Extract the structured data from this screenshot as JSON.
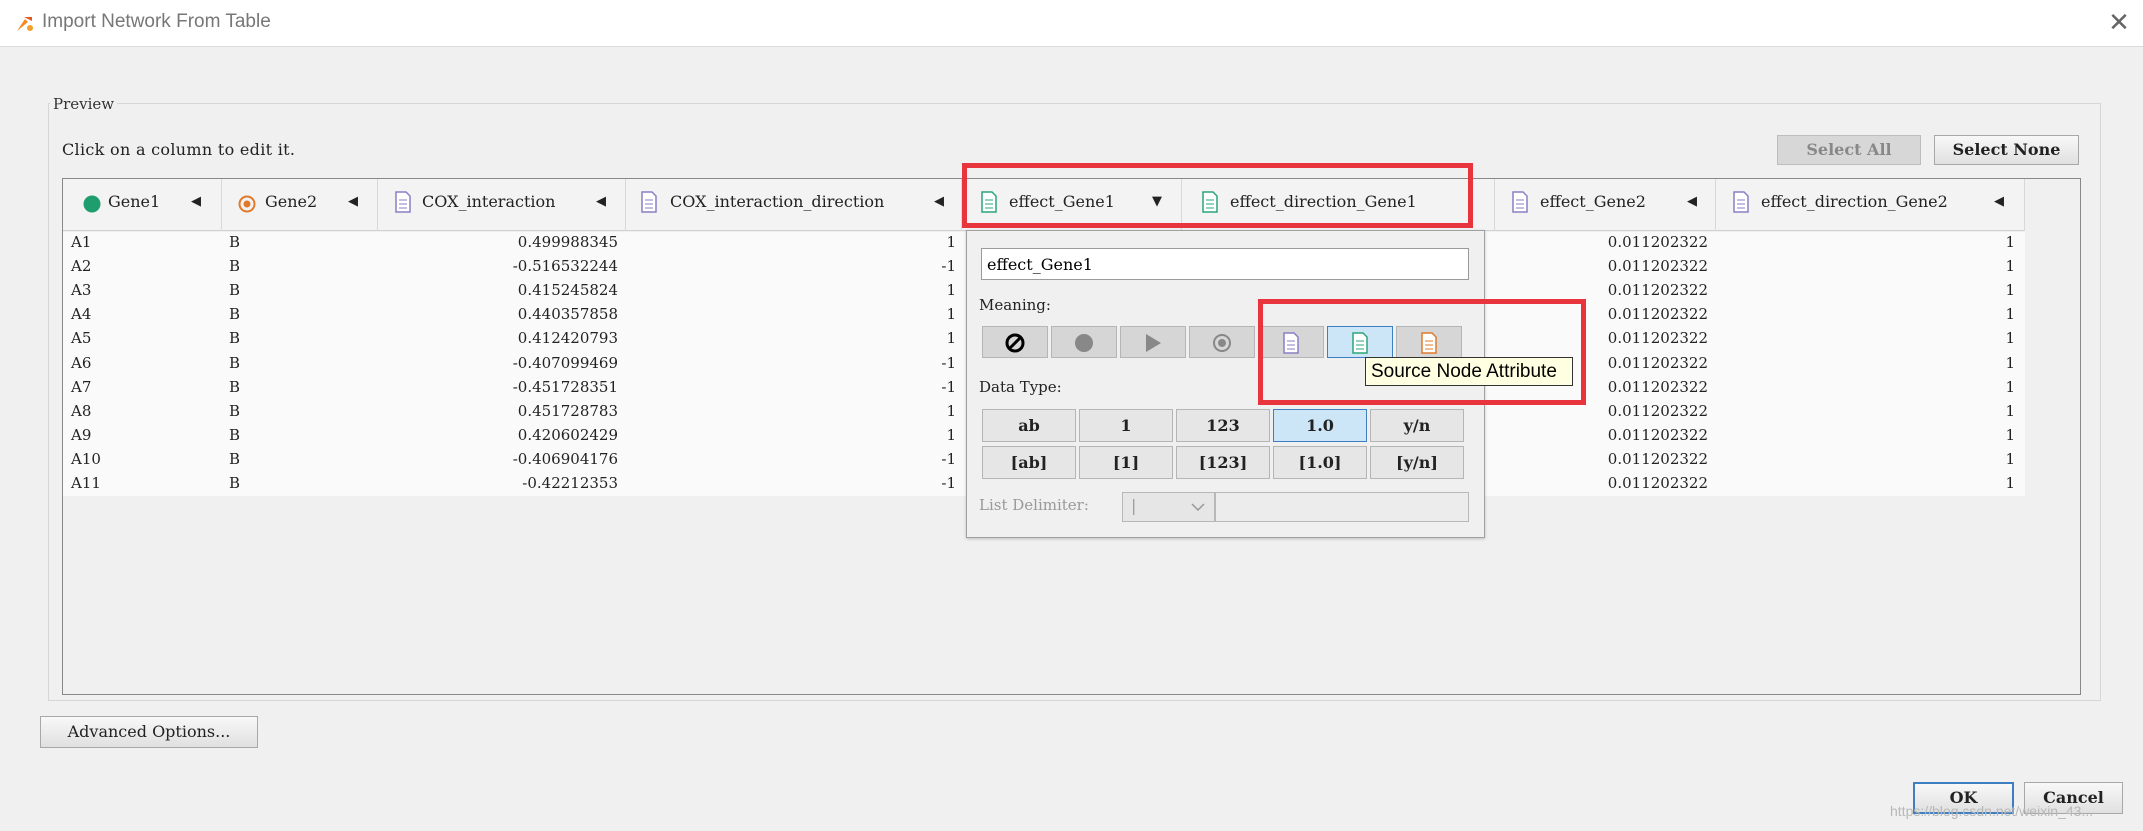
{
  "window": {
    "title": "Import Network From Table",
    "close_glyph": "✕"
  },
  "preview": {
    "group_label": "Preview",
    "hint": "Click on a column to edit it.",
    "select_all_label": "Select All",
    "select_none_label": "Select None"
  },
  "columns": [
    {
      "label": "Gene1",
      "meaning": "source-node",
      "arrow": "◀"
    },
    {
      "label": "Gene2",
      "meaning": "target-node",
      "arrow": "◀"
    },
    {
      "label": "COX_interaction",
      "meaning": "edge-attribute",
      "arrow": "◀"
    },
    {
      "label": "COX_interaction_direction",
      "meaning": "edge-attribute",
      "arrow": "◀"
    },
    {
      "label": "effect_Gene1",
      "meaning": "source-node-attribute",
      "arrow": "▼"
    },
    {
      "label": "effect_direction_Gene1",
      "meaning": "source-node-attribute",
      "arrow": ""
    },
    {
      "label": "effect_Gene2",
      "meaning": "edge-attribute",
      "arrow": "◀"
    },
    {
      "label": "effect_direction_Gene2",
      "meaning": "edge-attribute",
      "arrow": "◀"
    }
  ],
  "rows": [
    {
      "gene1": "A1",
      "gene2": "B",
      "cox": "0.499988345",
      "dir": "1",
      "eff2": "0.011202322",
      "dir2": "1"
    },
    {
      "gene1": "A2",
      "gene2": "B",
      "cox": "-0.516532244",
      "dir": "-1",
      "eff2": "0.011202322",
      "dir2": "1"
    },
    {
      "gene1": "A3",
      "gene2": "B",
      "cox": "0.415245824",
      "dir": "1",
      "eff2": "0.011202322",
      "dir2": "1"
    },
    {
      "gene1": "A4",
      "gene2": "B",
      "cox": "0.440357858",
      "dir": "1",
      "eff2": "0.011202322",
      "dir2": "1"
    },
    {
      "gene1": "A5",
      "gene2": "B",
      "cox": "0.412420793",
      "dir": "1",
      "eff2": "0.011202322",
      "dir2": "1"
    },
    {
      "gene1": "A6",
      "gene2": "B",
      "cox": "-0.407099469",
      "dir": "-1",
      "eff2": "0.011202322",
      "dir2": "1"
    },
    {
      "gene1": "A7",
      "gene2": "B",
      "cox": "-0.451728351",
      "dir": "-1",
      "eff2": "0.011202322",
      "dir2": "1"
    },
    {
      "gene1": "A8",
      "gene2": "B",
      "cox": "0.451728783",
      "dir": "1",
      "eff2": "0.011202322",
      "dir2": "1"
    },
    {
      "gene1": "A9",
      "gene2": "B",
      "cox": "0.420602429",
      "dir": "1",
      "eff2": "0.011202322",
      "dir2": "1"
    },
    {
      "gene1": "A10",
      "gene2": "B",
      "cox": "-0.406904176",
      "dir": "-1",
      "eff2": "0.011202322",
      "dir2": "1"
    },
    {
      "gene1": "A11",
      "gene2": "B",
      "cox": "-0.42212353",
      "dir": "-1",
      "eff2": "0.011202322",
      "dir2": "1"
    }
  ],
  "editor": {
    "column_name": "effect_Gene1",
    "meaning_label": "Meaning:",
    "meaning_options": [
      "not-imported-icon",
      "source-node-icon",
      "interaction-type-icon",
      "target-node-icon",
      "edge-attribute-icon",
      "source-node-attribute-icon",
      "target-node-attribute-icon"
    ],
    "selected_meaning": "source-node-attribute-icon",
    "tooltip": "Source Node Attribute",
    "data_type_label": "Data Type:",
    "data_types": [
      "ab",
      "1",
      "123",
      "1.0",
      "y/n",
      "[ab]",
      "[1]",
      "[123]",
      "[1.0]",
      "[y/n]"
    ],
    "selected_data_type": "1.0",
    "list_delimiter_label": "List Delimiter:",
    "list_delimiter_value": "|"
  },
  "footer": {
    "advanced_label": "Advanced Options...",
    "ok_label": "OK",
    "cancel_label": "Cancel",
    "watermark": "https://blog.csdn.net/weixin_43..."
  },
  "colors": {
    "source_node": "#1e9e6e",
    "target_node": "#e07a2a",
    "edge_attribute": "#8a7fc6",
    "source_node_attribute": "#2aa57a",
    "target_node_attribute": "#e07a2a",
    "annotation_red": "#e8343d",
    "selection_blue": "#cde6f7"
  }
}
